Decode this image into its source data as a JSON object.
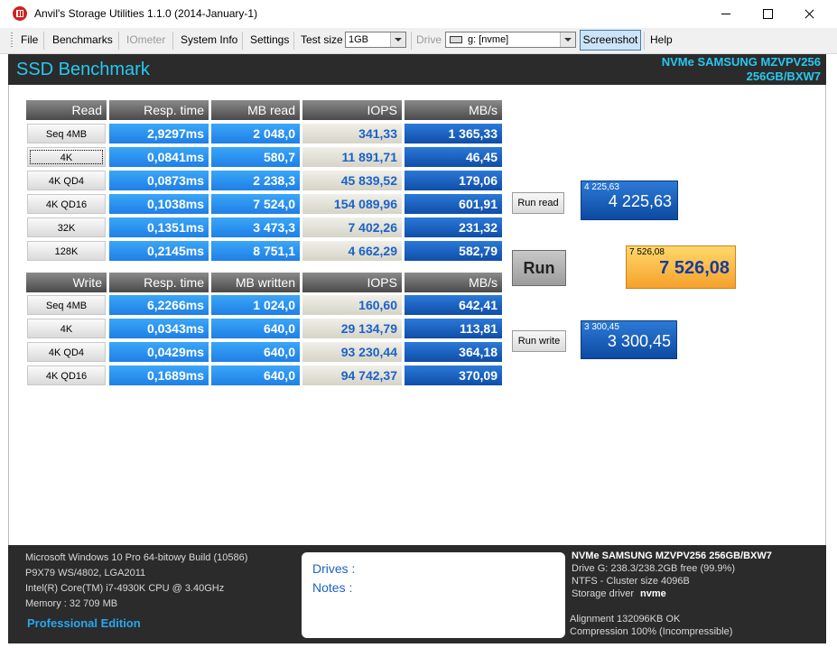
{
  "window": {
    "title": "Anvil's Storage Utilities 1.1.0 (2014-January-1)"
  },
  "menu": {
    "file": "File",
    "benchmarks": "Benchmarks",
    "iometer": "IOmeter",
    "system_info": "System Info",
    "settings": "Settings",
    "test_size_label": "Test size",
    "test_size_value": "1GB",
    "drive_label": "Drive",
    "drive_value": "g: [nvme]",
    "screenshot": "Screenshot",
    "help": "Help"
  },
  "header": {
    "title": "SSD Benchmark",
    "drive_line1": "NVMe  SAMSUNG  MZVPV256",
    "drive_line2": "256GB/BXW7"
  },
  "read_table": {
    "headers": [
      "Read",
      "Resp. time",
      "MB read",
      "IOPS",
      "MB/s"
    ],
    "rows": [
      {
        "label": "Seq 4MB",
        "resp": "2,9297ms",
        "mb": "2 048,0",
        "iops": "341,33",
        "mbs": "1 365,33"
      },
      {
        "label": "4K",
        "resp": "0,0841ms",
        "mb": "580,7",
        "iops": "11 891,71",
        "mbs": "46,45"
      },
      {
        "label": "4K QD4",
        "resp": "0,0873ms",
        "mb": "2 238,3",
        "iops": "45 839,52",
        "mbs": "179,06"
      },
      {
        "label": "4K QD16",
        "resp": "0,1038ms",
        "mb": "7 524,0",
        "iops": "154 089,96",
        "mbs": "601,91"
      },
      {
        "label": "32K",
        "resp": "0,1351ms",
        "mb": "3 473,3",
        "iops": "7 402,26",
        "mbs": "231,32"
      },
      {
        "label": "128K",
        "resp": "0,2145ms",
        "mb": "8 751,1",
        "iops": "4 662,29",
        "mbs": "582,79"
      }
    ]
  },
  "write_table": {
    "headers": [
      "Write",
      "Resp. time",
      "MB written",
      "IOPS",
      "MB/s"
    ],
    "rows": [
      {
        "label": "Seq 4MB",
        "resp": "6,2266ms",
        "mb": "1 024,0",
        "iops": "160,60",
        "mbs": "642,41"
      },
      {
        "label": "4K",
        "resp": "0,0343ms",
        "mb": "640,0",
        "iops": "29 134,79",
        "mbs": "113,81"
      },
      {
        "label": "4K QD4",
        "resp": "0,0429ms",
        "mb": "640,0",
        "iops": "93 230,44",
        "mbs": "364,18"
      },
      {
        "label": "4K QD16",
        "resp": "0,1689ms",
        "mb": "640,0",
        "iops": "94 742,37",
        "mbs": "370,09"
      }
    ]
  },
  "buttons": {
    "run_read": "Run read",
    "run": "Run",
    "run_write": "Run write"
  },
  "scores": {
    "read_small": "4 225,63",
    "read_big": "4 225,63",
    "total_small": "7 526,08",
    "total_big": "7 526,08",
    "write_small": "3 300,45",
    "write_big": "3 300,45"
  },
  "system": {
    "os": "Microsoft Windows 10 Pro 64-bitowy Build (10586)",
    "board": "P9X79 WS/4802, LGA2011",
    "cpu": "Intel(R) Core(TM) i7-4930K CPU @ 3.40GHz",
    "memory": "Memory : 32 709 MB",
    "edition": "Professional Edition"
  },
  "notes": {
    "drives": "Drives :",
    "notes": "Notes :"
  },
  "drive_info": {
    "name": "NVMe SAMSUNG MZVPV256 256GB/BXW7",
    "space": "Drive G: 238.3/238.2GB free (99.9%)",
    "fs": "NTFS - Cluster size 4096B",
    "driver_label": "Storage driver",
    "driver_value": "nvme",
    "alignment": "Alignment 132096KB OK",
    "compression": "Compression 100% (Incompressible)"
  }
}
